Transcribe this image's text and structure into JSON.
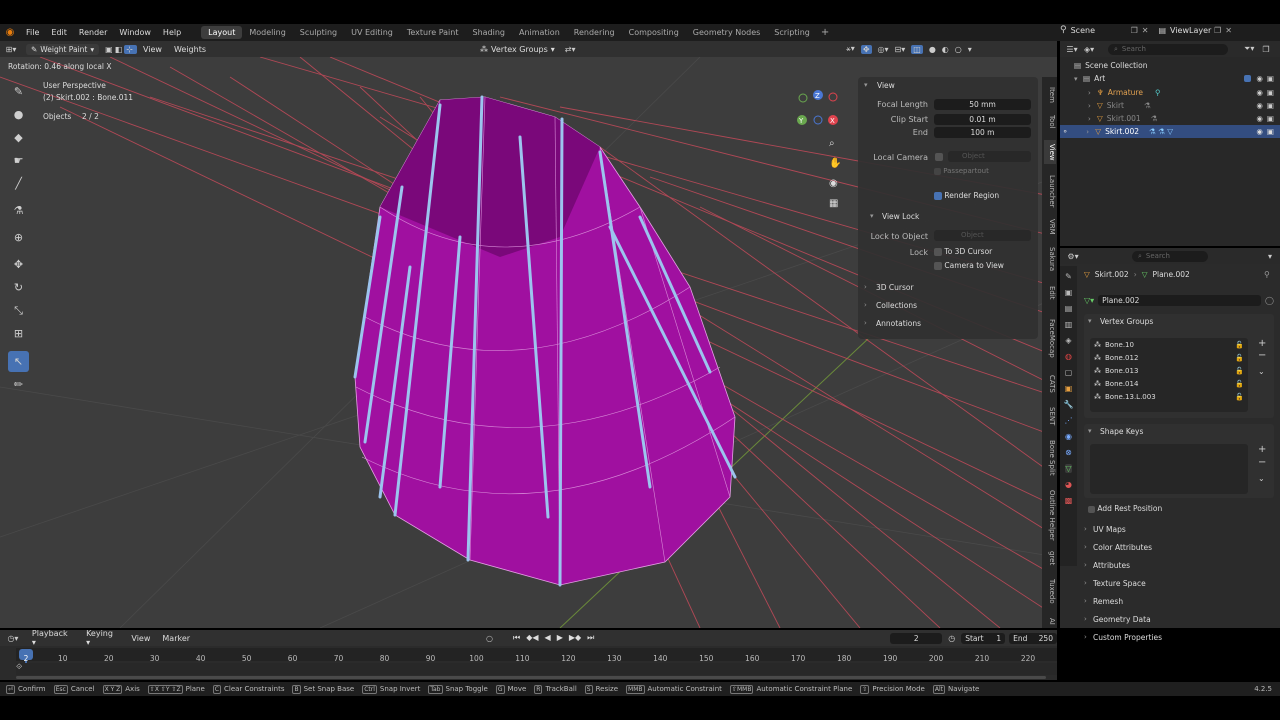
{
  "app": {
    "menus": [
      "File",
      "Edit",
      "Render",
      "Window",
      "Help"
    ],
    "workspaces": [
      "Layout",
      "Modeling",
      "Sculpting",
      "UV Editing",
      "Texture Paint",
      "Shading",
      "Animation",
      "Rendering",
      "Compositing",
      "Geometry Nodes",
      "Scripting"
    ],
    "active_workspace": "Layout",
    "scene": "Scene",
    "view_layer": "ViewLayer"
  },
  "viewport": {
    "mode": "Weight Paint",
    "header_menus": [
      "View",
      "Weights"
    ],
    "vertex_groups_label": "Vertex Groups",
    "status_text": "Rotation: 0.46 along local X",
    "perspective": "User Perspective",
    "active_info": "(2) Skirt.002 : Bone.011",
    "objects_label": "Objects",
    "objects_count": "2 / 2",
    "gizmo": {
      "x": "X",
      "y": "Y",
      "z": "Z",
      "x_color": "#e0434e",
      "y_color": "#6aa84f",
      "z_color": "#4a77d4"
    }
  },
  "npanel": {
    "view_title": "View",
    "focal_length_label": "Focal Length",
    "focal_length": "50 mm",
    "clip_start_label": "Clip Start",
    "clip_start": "0.01 m",
    "end_label": "End",
    "end": "100 m",
    "local_camera_label": "Local Camera",
    "object_placeholder": "Object",
    "passepartout": "Passepartout",
    "render_region": "Render Region",
    "view_lock_title": "View Lock",
    "lock_to_object_label": "Lock to Object",
    "lock_label": "Lock",
    "to_3d_cursor": "To 3D Cursor",
    "camera_to_view": "Camera to View",
    "collapsed": [
      "3D Cursor",
      "Collections",
      "Annotations"
    ],
    "tabs": [
      "Item",
      "Tool",
      "View",
      "Launcher",
      "VRM",
      "Sakura",
      "Edit",
      "FaceMocap",
      "CATS",
      "SENT",
      "Bone Split",
      "Outline Helper",
      "gret",
      "Tuxedo",
      "AI"
    ]
  },
  "outliner": {
    "search_placeholder": "Search",
    "root": "Scene Collection",
    "collection": "Art",
    "items": [
      "Armature",
      "Skirt",
      "Skirt.001",
      "Skirt.002"
    ],
    "selected_index": 3
  },
  "properties": {
    "search_placeholder": "Search",
    "breadcrumb_object": "Skirt.002",
    "breadcrumb_data": "Plane.002",
    "data_name": "Plane.002",
    "vertex_groups_title": "Vertex Groups",
    "vertex_groups": [
      "Bone.10",
      "Bone.012",
      "Bone.013",
      "Bone.014",
      "Bone.13.L.003"
    ],
    "shape_keys_title": "Shape Keys",
    "add_rest_position": "Add Rest Position",
    "sections": [
      "UV Maps",
      "Color Attributes",
      "Attributes",
      "Texture Space",
      "Remesh",
      "Geometry Data",
      "Custom Properties"
    ]
  },
  "timeline": {
    "menus": [
      "Playback",
      "Keying",
      "View",
      "Marker"
    ],
    "current_frame": "2",
    "start_label": "Start",
    "start": "1",
    "end_label": "End",
    "end": "250",
    "ticks": [
      "2",
      "10",
      "20",
      "30",
      "40",
      "50",
      "60",
      "70",
      "80",
      "90",
      "100",
      "110",
      "120",
      "130",
      "140",
      "150",
      "160",
      "170",
      "180",
      "190",
      "200",
      "210",
      "220"
    ]
  },
  "statusbar": {
    "items": [
      {
        "key": "⏎",
        "label": "Confirm"
      },
      {
        "key": "Esc",
        "label": "Cancel"
      },
      {
        "key": "X Y Z",
        "label": "Axis"
      },
      {
        "key": "⇧X ⇧Y ⇧Z",
        "label": "Plane"
      },
      {
        "key": "C",
        "label": "Clear Constraints"
      },
      {
        "key": "B",
        "label": "Set Snap Base"
      },
      {
        "key": "Ctrl",
        "label": "Snap Invert"
      },
      {
        "key": "Tab",
        "label": "Snap Toggle"
      },
      {
        "key": "G",
        "label": "Move"
      },
      {
        "key": "R",
        "label": "TrackBall"
      },
      {
        "key": "S",
        "label": "Resize"
      },
      {
        "key": "MMB",
        "label": "Automatic Constraint"
      },
      {
        "key": "⇧MMB",
        "label": "Automatic Constraint Plane"
      },
      {
        "key": "⇧",
        "label": "Precision Mode"
      },
      {
        "key": "Alt",
        "label": "Navigate"
      }
    ],
    "version": "4.2.5"
  }
}
